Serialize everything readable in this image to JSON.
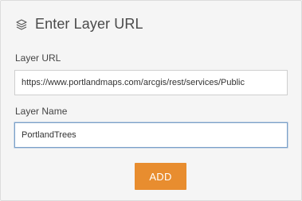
{
  "header": {
    "icon": "layers-icon",
    "title": "Enter Layer URL"
  },
  "layer_url": {
    "label": "Layer URL",
    "value": "https://www.portlandmaps.com/arcgis/rest/services/Public"
  },
  "layer_name": {
    "label": "Layer Name",
    "value": "PortlandTrees"
  },
  "actions": {
    "add_label": "ADD"
  },
  "colors": {
    "accent": "#e88d2f",
    "panel_background": "#f5f5f5",
    "focus_border": "#7aa0c8"
  }
}
